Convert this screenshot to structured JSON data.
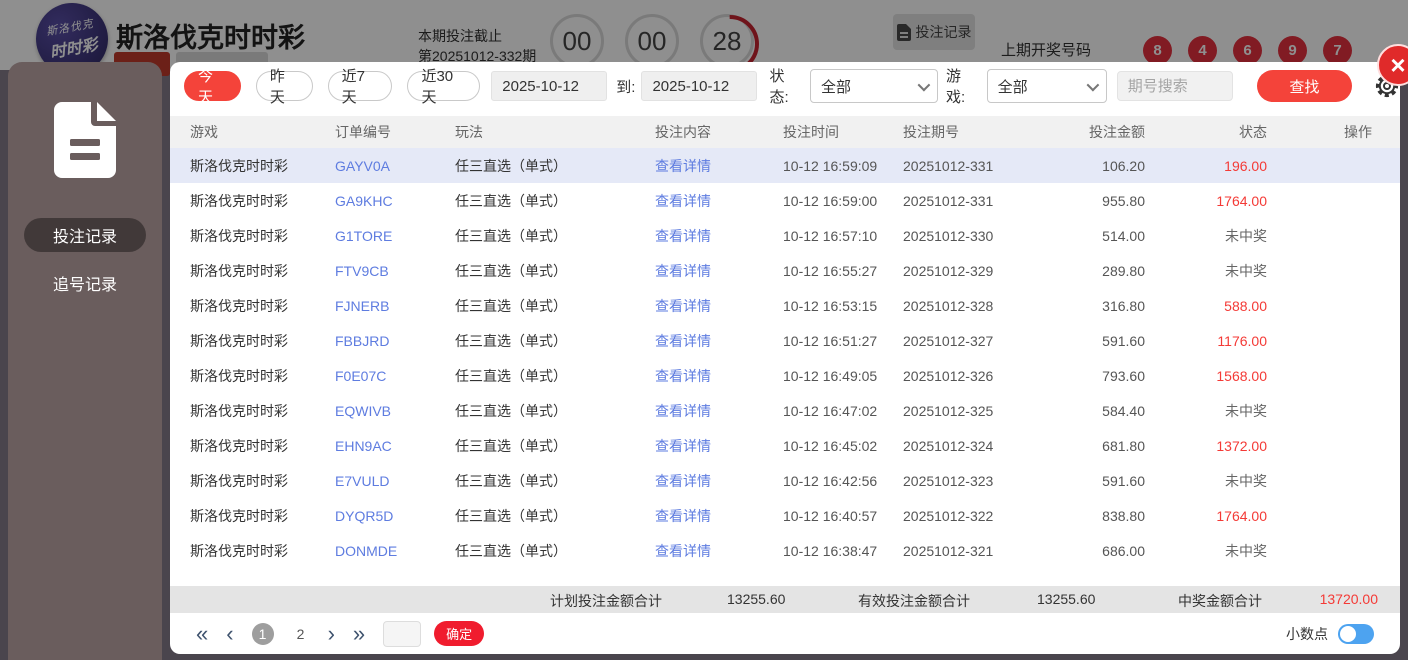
{
  "header": {
    "title": "斯洛伐克时时彩",
    "logo_line1": "斯洛伐克",
    "logo_line2": "时时彩",
    "deadline_label": "本期投注截止",
    "deadline_period": "第20251012-332期",
    "countdown": {
      "hours": "00",
      "minutes": "00",
      "seconds": "28"
    },
    "bet_record_button": "投注记录",
    "last_draw_label": "上期开奖号码",
    "last_draw_numbers": [
      "8",
      "4",
      "6",
      "9",
      "7"
    ]
  },
  "sidebar": {
    "items": [
      {
        "label": "投注记录",
        "active": true
      },
      {
        "label": "追号记录",
        "active": false
      }
    ]
  },
  "filters": {
    "quick": [
      {
        "label": "今天",
        "active": true
      },
      {
        "label": "昨天",
        "active": false
      },
      {
        "label": "近7天",
        "active": false
      },
      {
        "label": "近30天",
        "active": false
      }
    ],
    "date_from": "2025-10-12",
    "to_label": "到:",
    "date_to": "2025-10-12",
    "status_label": "状态:",
    "status_value": "全部",
    "game_label": "游戏:",
    "game_value": "全部",
    "search_placeholder": "期号搜索",
    "search_button": "查找"
  },
  "table": {
    "headers": [
      "游戏",
      "订单编号",
      "玩法",
      "投注内容",
      "投注时间",
      "投注期号",
      "投注金额",
      "状态",
      "操作"
    ],
    "detail_link": "查看详情",
    "rows": [
      {
        "game": "斯洛伐克时时彩",
        "order": "GAYV0A",
        "play": "任三直选（单式）",
        "time": "10-12 16:59:09",
        "period": "20251012-331",
        "amount": "106.20",
        "status": "196.00",
        "win": true,
        "highlight": true
      },
      {
        "game": "斯洛伐克时时彩",
        "order": "GA9KHC",
        "play": "任三直选（单式）",
        "time": "10-12 16:59:00",
        "period": "20251012-331",
        "amount": "955.80",
        "status": "1764.00",
        "win": true,
        "highlight": false
      },
      {
        "game": "斯洛伐克时时彩",
        "order": "G1TORE",
        "play": "任三直选（单式）",
        "time": "10-12 16:57:10",
        "period": "20251012-330",
        "amount": "514.00",
        "status": "未中奖",
        "win": false,
        "highlight": false
      },
      {
        "game": "斯洛伐克时时彩",
        "order": "FTV9CB",
        "play": "任三直选（单式）",
        "time": "10-12 16:55:27",
        "period": "20251012-329",
        "amount": "289.80",
        "status": "未中奖",
        "win": false,
        "highlight": false
      },
      {
        "game": "斯洛伐克时时彩",
        "order": "FJNERB",
        "play": "任三直选（单式）",
        "time": "10-12 16:53:15",
        "period": "20251012-328",
        "amount": "316.80",
        "status": "588.00",
        "win": true,
        "highlight": false
      },
      {
        "game": "斯洛伐克时时彩",
        "order": "FBBJRD",
        "play": "任三直选（单式）",
        "time": "10-12 16:51:27",
        "period": "20251012-327",
        "amount": "591.60",
        "status": "1176.00",
        "win": true,
        "highlight": false
      },
      {
        "game": "斯洛伐克时时彩",
        "order": "F0E07C",
        "play": "任三直选（单式）",
        "time": "10-12 16:49:05",
        "period": "20251012-326",
        "amount": "793.60",
        "status": "1568.00",
        "win": true,
        "highlight": false
      },
      {
        "game": "斯洛伐克时时彩",
        "order": "EQWIVB",
        "play": "任三直选（单式）",
        "time": "10-12 16:47:02",
        "period": "20251012-325",
        "amount": "584.40",
        "status": "未中奖",
        "win": false,
        "highlight": false
      },
      {
        "game": "斯洛伐克时时彩",
        "order": "EHN9AC",
        "play": "任三直选（单式）",
        "time": "10-12 16:45:02",
        "period": "20251012-324",
        "amount": "681.80",
        "status": "1372.00",
        "win": true,
        "highlight": false
      },
      {
        "game": "斯洛伐克时时彩",
        "order": "E7VULD",
        "play": "任三直选（单式）",
        "time": "10-12 16:42:56",
        "period": "20251012-323",
        "amount": "591.60",
        "status": "未中奖",
        "win": false,
        "highlight": false
      },
      {
        "game": "斯洛伐克时时彩",
        "order": "DYQR5D",
        "play": "任三直选（单式）",
        "time": "10-12 16:40:57",
        "period": "20251012-322",
        "amount": "838.80",
        "status": "1764.00",
        "win": true,
        "highlight": false
      },
      {
        "game": "斯洛伐克时时彩",
        "order": "DONMDE",
        "play": "任三直选（单式）",
        "time": "10-12 16:38:47",
        "period": "20251012-321",
        "amount": "686.00",
        "status": "未中奖",
        "win": false,
        "highlight": false
      }
    ]
  },
  "summary": {
    "planned_label": "计划投注金额合计",
    "planned_value": "13255.60",
    "valid_label": "有效投注金额合计",
    "valid_value": "13255.60",
    "win_label": "中奖金额合计",
    "win_value": "13720.00"
  },
  "pagination": {
    "pages": [
      "1",
      "2"
    ],
    "current": "1",
    "confirm_button": "确定",
    "decimal_label": "小数点",
    "close_label": "×"
  },
  "colors": {
    "accent_red": "#f4433a",
    "link_blue": "#5e7ce0",
    "win_red": "#f43a36",
    "ball_red": "#e6303f",
    "sidebar_taupe": "#6a5d5d",
    "toggle_blue": "#4da3f0",
    "row_highlight": "#e5e9f7"
  }
}
